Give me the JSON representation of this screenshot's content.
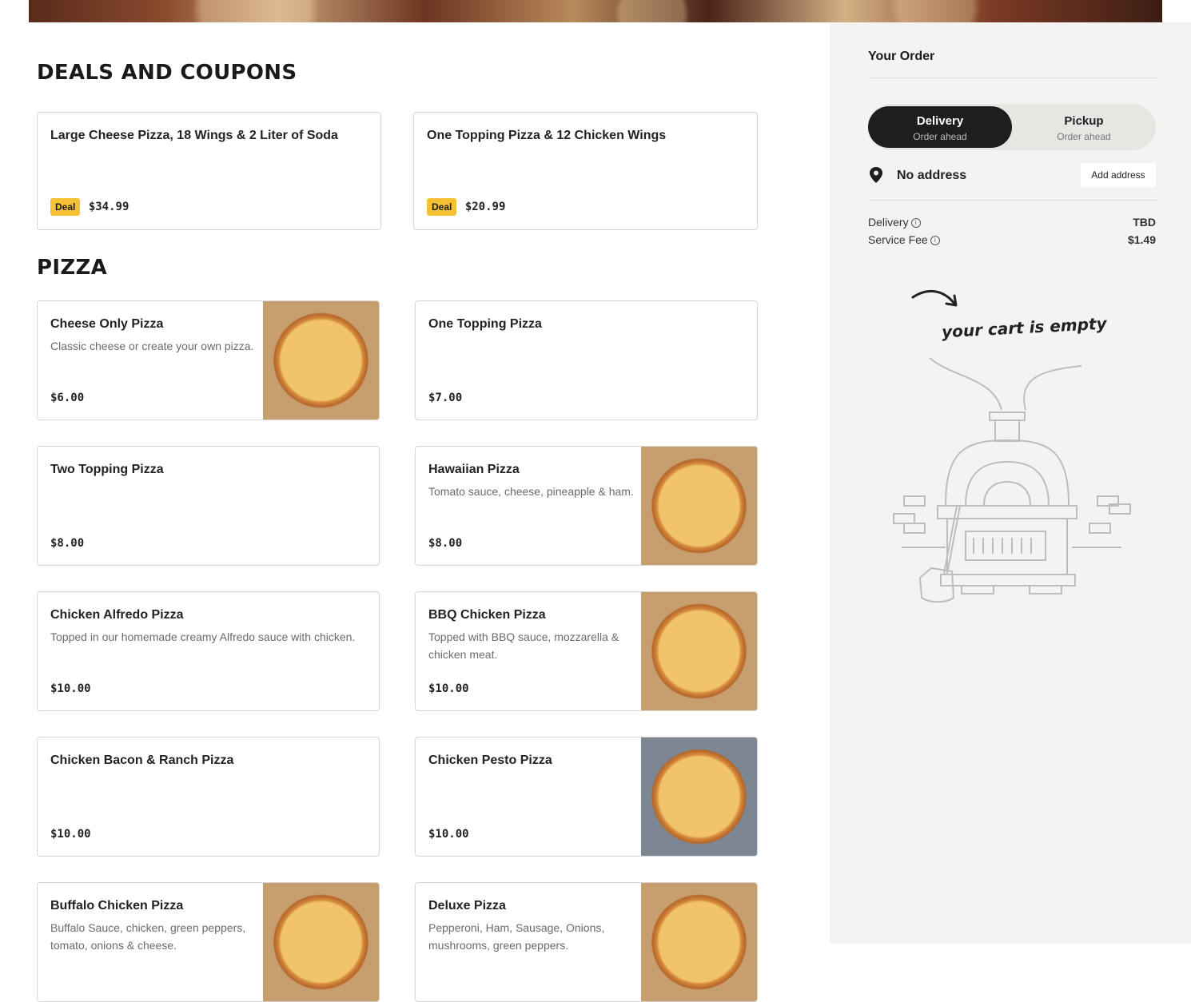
{
  "deals": {
    "title": "DEALS AND COUPONS",
    "items": [
      {
        "name": "Large Cheese Pizza, 18 Wings & 2 Liter of Soda",
        "badge": "Deal",
        "price": "$34.99"
      },
      {
        "name": "One Topping Pizza & 12 Chicken Wings",
        "badge": "Deal",
        "price": "$20.99"
      }
    ]
  },
  "pizza": {
    "title": "PIZZA",
    "items": [
      {
        "name": "Cheese Only Pizza",
        "desc": "Classic cheese or create your own pizza.",
        "price": "$6.00"
      },
      {
        "name": "One Topping Pizza",
        "desc": "",
        "price": "$7.00"
      },
      {
        "name": "Two Topping Pizza",
        "desc": "",
        "price": "$8.00"
      },
      {
        "name": "Hawaiian Pizza",
        "desc": "Tomato sauce, cheese, pineapple & ham.",
        "price": "$8.00"
      },
      {
        "name": "Chicken Alfredo Pizza",
        "desc": "Topped in our homemade creamy Alfredo sauce with chicken.",
        "price": "$10.00"
      },
      {
        "name": "BBQ Chicken Pizza",
        "desc": "Topped with BBQ sauce, mozzarella & chicken meat.",
        "price": "$10.00"
      },
      {
        "name": "Chicken Bacon & Ranch Pizza",
        "desc": "",
        "price": "$10.00"
      },
      {
        "name": "Chicken Pesto Pizza",
        "desc": "",
        "price": "$10.00"
      },
      {
        "name": "Buffalo Chicken Pizza",
        "desc": "Buffalo Sauce, chicken, green peppers, tomato, onions & cheese.",
        "price": ""
      },
      {
        "name": "Deluxe Pizza",
        "desc": "Pepperoni, Ham, Sausage, Onions, mushrooms, green peppers.",
        "price": ""
      }
    ]
  },
  "order": {
    "title": "Your Order",
    "delivery": {
      "label": "Delivery",
      "sub": "Order ahead"
    },
    "pickup": {
      "label": "Pickup",
      "sub": "Order ahead"
    },
    "address": "No address",
    "add_address": "Add address",
    "fees": [
      {
        "label": "Delivery",
        "value": "TBD"
      },
      {
        "label": "Service Fee",
        "value": "$1.49"
      }
    ],
    "empty_text": "your cart is empty"
  },
  "icons": {
    "address": "location-pin-icon",
    "info": "info-icon",
    "arrow": "curved-arrow-icon"
  }
}
